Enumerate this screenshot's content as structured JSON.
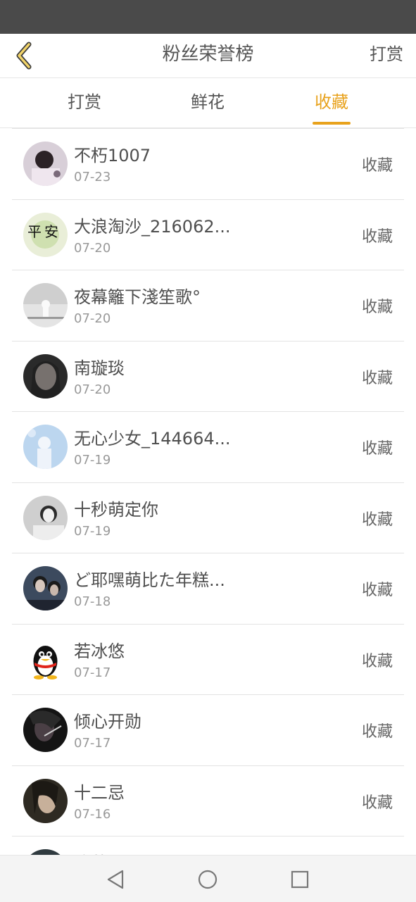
{
  "header": {
    "title": "粉丝荣誉榜",
    "right_label": "打赏"
  },
  "tabs": [
    {
      "label": "打赏",
      "active": false
    },
    {
      "label": "鲜花",
      "active": false
    },
    {
      "label": "收藏",
      "active": true
    }
  ],
  "colors": {
    "accent": "#e8a21c",
    "status_bar": "#4a4a4a"
  },
  "rows": [
    {
      "name": "不朽1007",
      "date": "07-23",
      "action": "收藏"
    },
    {
      "name": "大浪淘沙_216062...",
      "date": "07-20",
      "action": "收藏"
    },
    {
      "name": "夜幕籬下淺笙歌°",
      "date": "07-20",
      "action": "收藏"
    },
    {
      "name": "南璇琰",
      "date": "07-20",
      "action": "收藏"
    },
    {
      "name": "无心少女_144664...",
      "date": "07-19",
      "action": "收藏"
    },
    {
      "name": "十秒萌定你",
      "date": "07-19",
      "action": "收藏"
    },
    {
      "name": "ど耶嘿萌比た年糕...",
      "date": "07-18",
      "action": "收藏"
    },
    {
      "name": "若冰悠",
      "date": "07-17",
      "action": "收藏"
    },
    {
      "name": "倾心开勋",
      "date": "07-17",
      "action": "收藏"
    },
    {
      "name": "十二忌",
      "date": "07-16",
      "action": "收藏"
    },
    {
      "name": "滚萝",
      "date": "",
      "action": ""
    }
  ]
}
